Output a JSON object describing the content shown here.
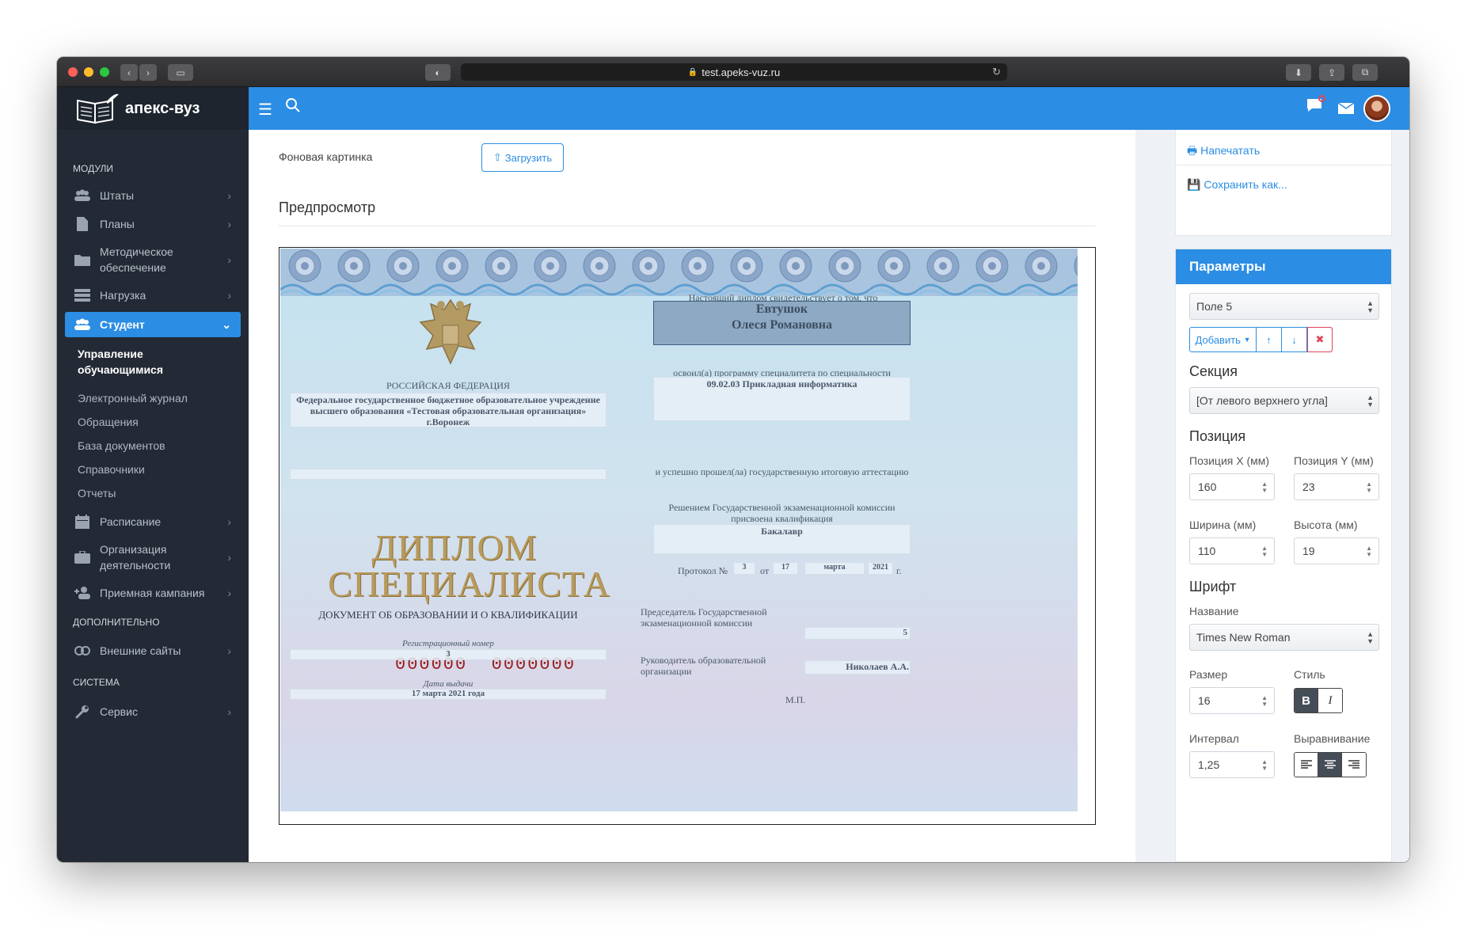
{
  "browser": {
    "url": "test.apeks-vuz.ru"
  },
  "brand": {
    "name": "апекс-вуз"
  },
  "sidebar": {
    "sections": {
      "modules": "МОДУЛИ",
      "additional": "ДОПОЛНИТЕЛЬНО",
      "system": "СИСТЕМА"
    },
    "items": {
      "staff": "Штаты",
      "plans": "Планы",
      "methodical": "Методическое обеспечение",
      "load": "Нагрузка",
      "student": "Студент",
      "schedule": "Расписание",
      "organization": "Организация деятельности",
      "admission": "Приемная кампания",
      "external": "Внешние сайты",
      "service": "Сервис"
    },
    "student_sub": {
      "manage": "Управление обучающимися",
      "journal": "Электронный журнал",
      "requests": "Обращения",
      "docs": "База документов",
      "refs": "Справочники",
      "reports": "Отчеты"
    }
  },
  "main": {
    "background_label": "Фоновая картинка",
    "upload_label": "Загрузить",
    "preview_title": "Предпросмотр"
  },
  "diploma": {
    "certifies": "Настоящий диплом свидетельствует о том, что",
    "surname": "Евтушок",
    "name": "Олеся Романовна",
    "country": "РОССИЙСКАЯ ФЕДЕРАЦИЯ",
    "org": "Федеральное государственное бюджетное образовательное учреждение высшего образования «Тестовая образовательная организация» г.Воронеж",
    "mastered": "освоил(а) программу специалитета по специальности",
    "specialty": "09.02.03 Прикладная информатика",
    "passed": "и успешно прошел(ла) государственную итоговую аттестацию",
    "title_line1": "ДИПЛОМ",
    "title_line2": "СПЕЦИАЛИСТА",
    "decision": "Решением Государственной экзаменационной комиссии присвоена квалификация",
    "qualification": "Бакалавр",
    "protocol": "Протокол №",
    "protocol_no": "3",
    "from": "от",
    "day": "17",
    "month": "марта",
    "year": "2021",
    "year_suffix": "г.",
    "serial_a": "000000",
    "serial_b": "0000000",
    "doc_type": "ДОКУМЕНТ ОБ ОБРАЗОВАНИИ И О КВАЛИФИКАЦИИ",
    "chairman": "Председатель Государственной экзаменационной комиссии",
    "chairman_value": "5",
    "reg_label": "Регистрационный номер",
    "reg_value": "3",
    "head": "Руководитель образовательной организации",
    "head_value": "Николаев А.А.",
    "issue_label": "Дата выдачи",
    "issue_value": "17 марта 2021 года",
    "stamp": "М.П."
  },
  "actions": {
    "print": "Напечатать",
    "save_as": "Сохранить как..."
  },
  "params": {
    "header": "Параметры",
    "field_select": "Поле 5",
    "add": "Добавить",
    "section_title": "Секция",
    "section_select": "[От левого верхнего угла]",
    "position_title": "Позиция",
    "pos_x_label": "Позиция X (мм)",
    "pos_x": "160",
    "pos_y_label": "Позиция Y (мм)",
    "pos_y": "23",
    "width_label": "Ширина (мм)",
    "width": "110",
    "height_label": "Высота (мм)",
    "height": "19",
    "font_title": "Шрифт",
    "font_name_label": "Название",
    "font_name": "Times New Roman",
    "size_label": "Размер",
    "size": "16",
    "style_label": "Стиль",
    "bold": "B",
    "italic": "I",
    "interval_label": "Интервал",
    "interval": "1,25",
    "align_label": "Выравнивание"
  },
  "colors": {
    "accent": "#2b8de3",
    "sidebar": "#232a35",
    "danger": "#e0445a"
  }
}
